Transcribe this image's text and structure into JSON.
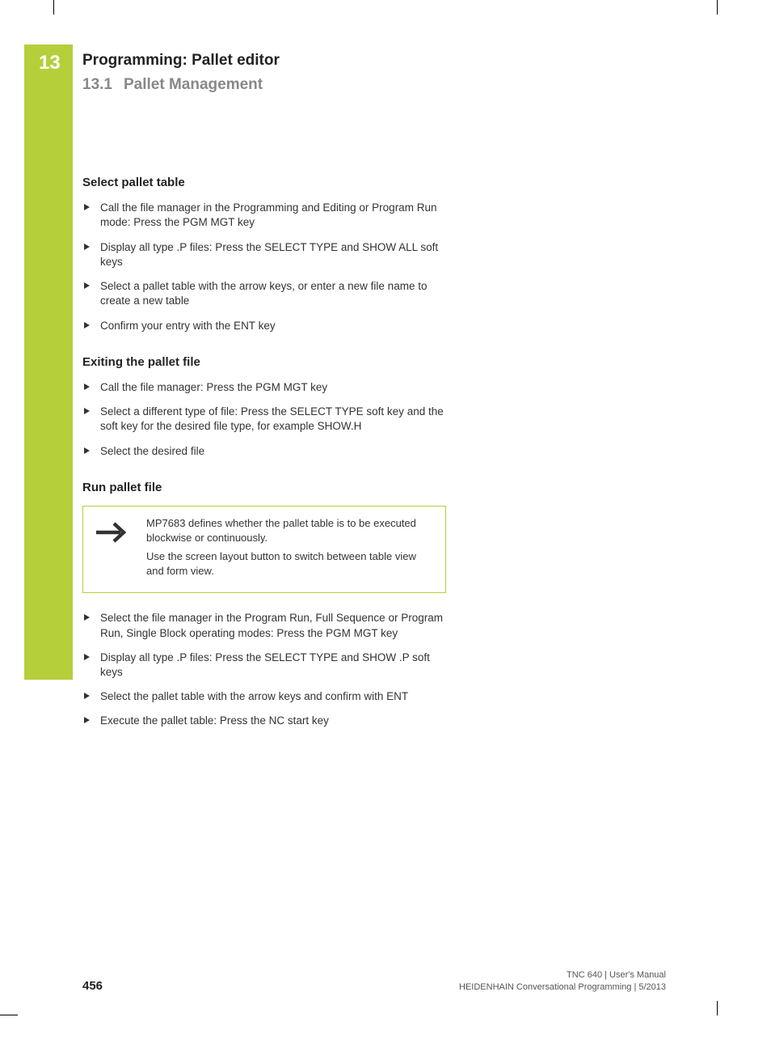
{
  "chapter": {
    "number": "13",
    "title": "Programming: Pallet editor"
  },
  "section": {
    "number": "13.1",
    "title": "Pallet Management"
  },
  "blocks": [
    {
      "heading": "Select pallet table",
      "items": [
        "Call the file manager in the Programming and Editing or Program Run mode: Press the PGM MGT key",
        "Display all type .P files: Press the SELECT TYPE and SHOW ALL soft keys",
        "Select a pallet table with the arrow keys, or enter a new file name to create a new table",
        "Confirm your entry with the ENT key"
      ]
    },
    {
      "heading": "Exiting the pallet file",
      "items": [
        "Call the file manager: Press the PGM MGT key",
        "Select a different type of file: Press the SELECT TYPE soft key and the soft key for the desired file type, for example SHOW.H",
        "Select the desired file"
      ]
    }
  ],
  "run_block": {
    "heading": "Run pallet file",
    "note": [
      "MP7683 defines whether the pallet table is to be executed blockwise or continuously.",
      "Use the screen layout button to switch between table view and form view."
    ],
    "items": [
      "Select the file manager in the Program Run, Full Sequence or Program Run, Single Block operating modes: Press the PGM MGT key",
      "Display all type .P files: Press the SELECT TYPE and SHOW .P soft keys",
      "Select the pallet table with the arrow keys and confirm with ENT",
      "Execute the pallet table: Press the NC start key"
    ]
  },
  "footer": {
    "page": "456",
    "line1": "TNC 640 | User's Manual",
    "line2": "HEIDENHAIN Conversational Programming | 5/2013"
  }
}
